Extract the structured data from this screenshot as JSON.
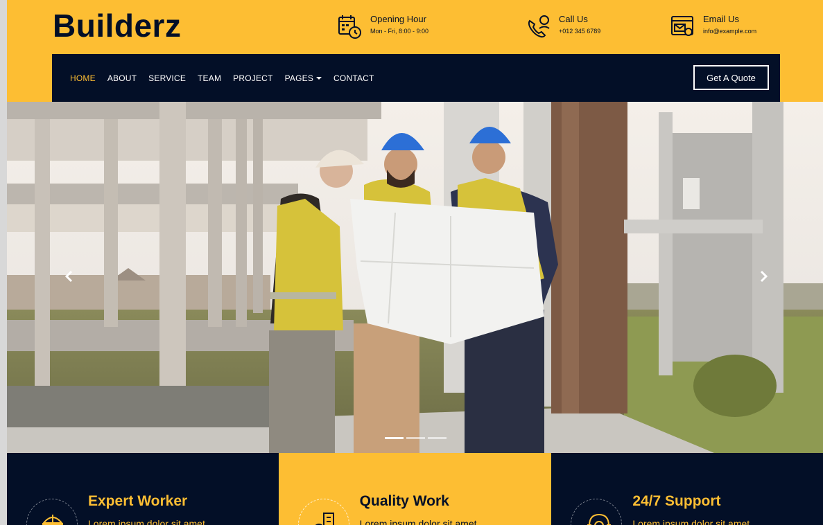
{
  "brand": "Builderz",
  "contact": [
    {
      "label": "Opening Hour",
      "value": "Mon - Fri, 8:00 - 9:00",
      "icon": "calendar-clock-icon"
    },
    {
      "label": "Call Us",
      "value": "+012 345 6789",
      "icon": "phone-call-icon"
    },
    {
      "label": "Email Us",
      "value": "info@example.com",
      "icon": "email-icon"
    }
  ],
  "nav": {
    "items": [
      "HOME",
      "ABOUT",
      "SERVICE",
      "TEAM",
      "PROJECT",
      "PAGES",
      "CONTACT"
    ],
    "active": "HOME",
    "quote_button": "Get A Quote"
  },
  "carousel": {
    "prev_icon": "chevron-left-icon",
    "next_icon": "chevron-right-icon",
    "slides": 3,
    "active_slide": 1
  },
  "features": [
    {
      "title": "Expert Worker",
      "desc": "Lorem ipsum dolor sit amet",
      "icon": "worker-helmet-icon"
    },
    {
      "title": "Quality Work",
      "desc": "Lorem ipsum dolor sit amet",
      "icon": "building-icon"
    },
    {
      "title": "24/7 Support",
      "desc": "Lorem ipsum dolor sit amet",
      "icon": "support-headset-icon"
    }
  ],
  "colors": {
    "accent": "#fdbe33",
    "dark": "#030f27"
  }
}
